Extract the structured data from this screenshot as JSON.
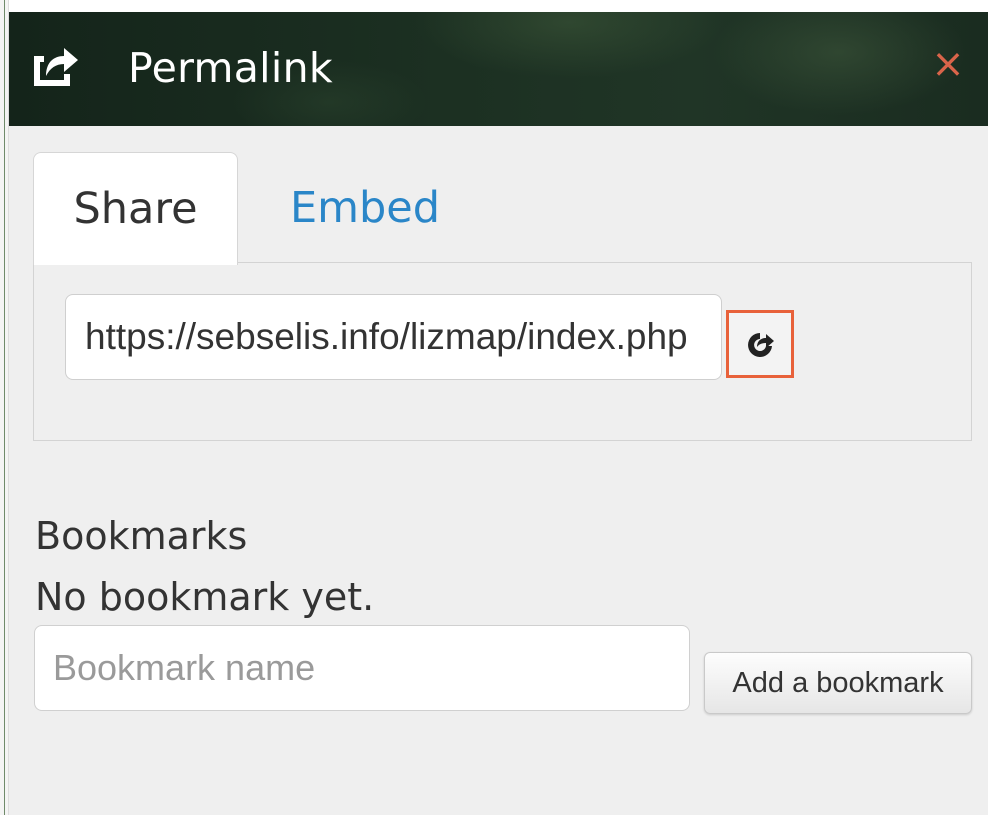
{
  "dialog": {
    "title": "Permalink",
    "close_label": "×",
    "header_icon": "share-icon",
    "accent_color": "#e8613a"
  },
  "tabs": [
    {
      "label": "Share",
      "active": true
    },
    {
      "label": "Embed",
      "active": false
    }
  ],
  "share": {
    "url_value": "https://sebselis.info/lizmap/index.php",
    "open_link_icon": "share-icon"
  },
  "bookmarks": {
    "heading": "Bookmarks",
    "empty_message": "No bookmark yet.",
    "name_placeholder": "Bookmark name",
    "add_button_label": "Add a bookmark"
  },
  "colors": {
    "header_bg": "#1c3022",
    "tab_link": "#2a86c8",
    "close": "#d9644a"
  }
}
